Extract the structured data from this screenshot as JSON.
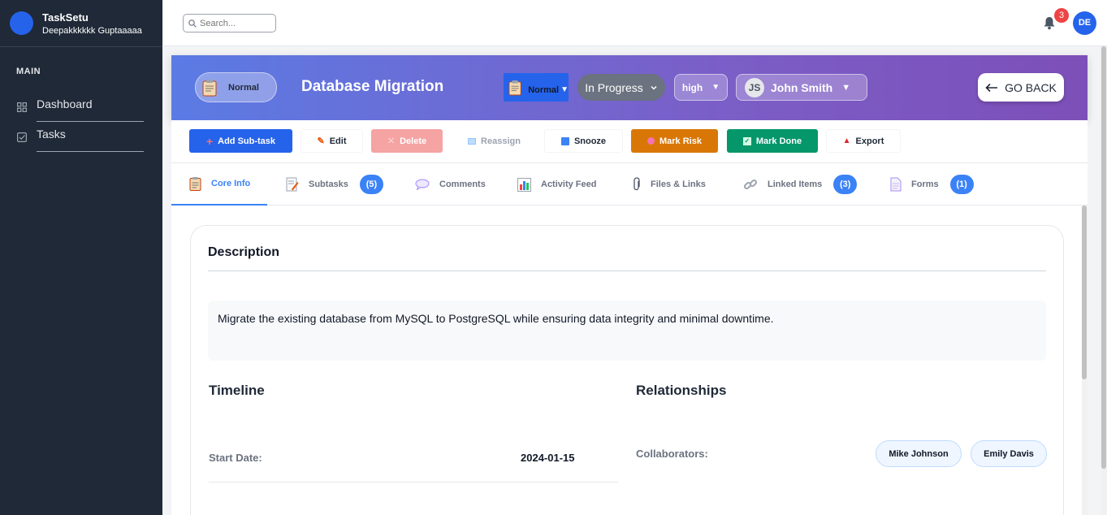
{
  "app": {
    "name": "TaskSetu",
    "user": "Deepakkkkkk Guptaaaaa"
  },
  "sidebar": {
    "section": "MAIN",
    "items": [
      {
        "label": "Dashboard",
        "icon": "grid-icon"
      },
      {
        "label": "Tasks",
        "icon": "checkbox-icon"
      }
    ]
  },
  "topbar": {
    "search_placeholder": "Search...",
    "notification_count": "3",
    "avatar_initials": "DE"
  },
  "header": {
    "type_label": "Normal",
    "title": "Database Migration",
    "type_select": "Normal",
    "status": "In Progress",
    "priority": "high",
    "assignee_initials": "JS",
    "assignee": "John Smith",
    "go_back": "GO BACK"
  },
  "actions": [
    {
      "label": "Add Sub-task"
    },
    {
      "label": "Edit"
    },
    {
      "label": "Delete"
    },
    {
      "label": "Reassign"
    },
    {
      "label": "Snooze"
    },
    {
      "label": "Mark Risk"
    },
    {
      "label": "Mark Done"
    },
    {
      "label": "Export"
    }
  ],
  "tabs": [
    {
      "label": "Core Info"
    },
    {
      "label": "Subtasks",
      "count": "(5)"
    },
    {
      "label": "Comments"
    },
    {
      "label": "Activity Feed"
    },
    {
      "label": "Files & Links"
    },
    {
      "label": "Linked Items",
      "count": "(3)"
    },
    {
      "label": "Forms",
      "count": "(1)"
    }
  ],
  "core": {
    "description_heading": "Description",
    "description": "Migrate the existing database from MySQL to PostgreSQL while ensuring data integrity and minimal downtime.",
    "timeline_heading": "Timeline",
    "start_date_label": "Start Date:",
    "start_date": "2024-01-15",
    "relationships_heading": "Relationships",
    "collaborators_label": "Collaborators:",
    "collaborators": [
      "Mike Johnson",
      "Emily Davis"
    ]
  },
  "colors": {
    "accent": "#3b82f6",
    "sidebar": "#1f2937",
    "header_from": "#5b7be4",
    "header_to": "#7d4fb8",
    "risk": "#d97706",
    "done": "#059669",
    "notification": "#ef4444"
  }
}
